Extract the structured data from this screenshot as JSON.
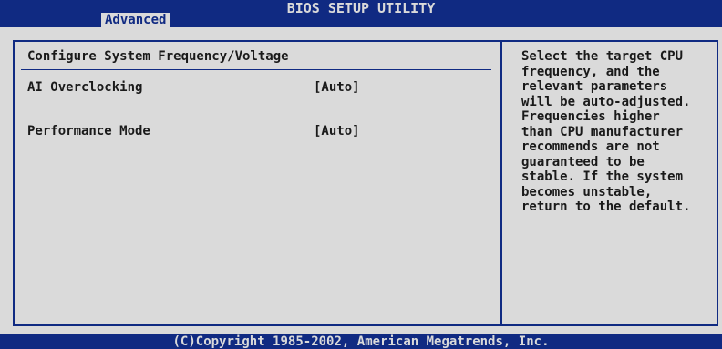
{
  "header": {
    "title": "BIOS SETUP UTILITY",
    "active_tab": "Advanced"
  },
  "main": {
    "section_title": "Configure System Frequency/Voltage",
    "rows": [
      {
        "label": "AI Overclocking",
        "value": "[Auto]"
      },
      {
        "label": "Performance Mode",
        "value": "[Auto]"
      }
    ]
  },
  "help": {
    "lines": [
      "Select the target CPU",
      "frequency, and the",
      "relevant parameters",
      "will be auto-adjusted.",
      "Frequencies higher",
      "than CPU manufacturer",
      "recommends are not",
      "guaranteed to be",
      "stable. If the system",
      "becomes unstable,",
      "return to the default."
    ]
  },
  "footer": {
    "copyright": "(C)Copyright 1985-2002, American Megatrends, Inc."
  },
  "colors": {
    "bios_blue": "#102a82",
    "bios_gray": "#dadada",
    "text": "#1a1a1a"
  }
}
